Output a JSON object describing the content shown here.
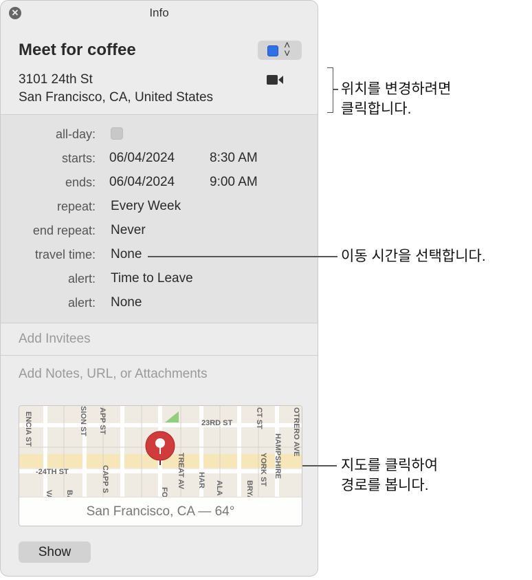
{
  "window": {
    "title": "Info"
  },
  "event": {
    "title": "Meet for coffee",
    "calendar_color": "#2f6fe8",
    "location_line1": "3101 24th St",
    "location_line2": "San Francisco, CA, United States"
  },
  "details": {
    "allday_label": "all-day:",
    "starts_label": "starts:",
    "starts_date": "06/04/2024",
    "starts_time": "8:30 AM",
    "ends_label": "ends:",
    "ends_date": "06/04/2024",
    "ends_time": "9:00 AM",
    "repeat_label": "repeat:",
    "repeat_value": "Every Week",
    "end_repeat_label": "end repeat:",
    "end_repeat_value": "Never",
    "travel_label": "travel time:",
    "travel_value": "None",
    "alert1_label": "alert:",
    "alert1_value": "Time to Leave",
    "alert2_label": "alert:",
    "alert2_value": "None"
  },
  "invitees_placeholder": "Add Invitees",
  "notes_placeholder": "Add Notes, URL, or Attachments",
  "map": {
    "caption": "San Francisco, CA — 64°",
    "streets": [
      "ENCIA ST",
      "SION ST",
      "APP ST",
      "23RD ST",
      "CT ST",
      "OTRERO AVE",
      "HAMPSHIRE",
      "YORK ST",
      "-24TH ST",
      "CAPP S",
      "TREAT AV",
      "HAR",
      "ALA",
      "BRYANT",
      "FO",
      "VALEN",
      "BARTLE"
    ]
  },
  "show_button": "Show",
  "callouts": {
    "location": [
      "위치를 변경하려면",
      "클릭합니다."
    ],
    "travel": "이동 시간을 선택합니다.",
    "map": [
      "지도를 클릭하여",
      "경로를 봅니다."
    ]
  }
}
